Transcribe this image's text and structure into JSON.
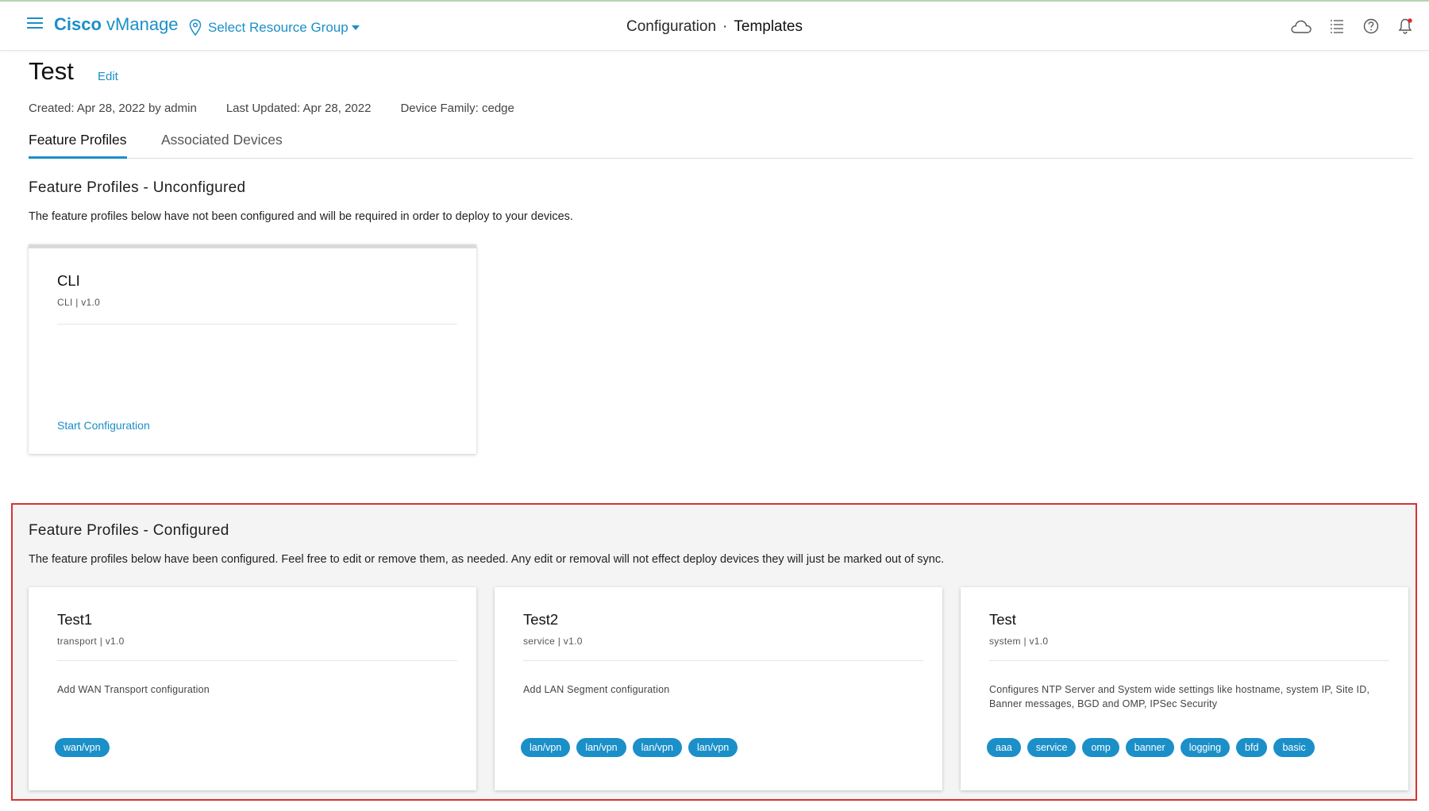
{
  "topbar": {
    "brand_bold": "Cisco",
    "brand_rest": " vManage",
    "resource_group": "Select Resource Group",
    "breadcrumb_parent": "Configuration",
    "breadcrumb_sep": "·",
    "breadcrumb_current": "Templates",
    "icons": [
      "cloud-icon",
      "task-list-icon",
      "help-icon",
      "notification-bell-icon"
    ],
    "accent_color": "#1b8fc8",
    "alert_color": "#e0282e"
  },
  "header": {
    "title": "Test",
    "edit_label": "Edit",
    "created": "Created: Apr 28, 2022 by admin",
    "last_updated": "Last Updated: Apr 28, 2022",
    "device_family": "Device Family: cedge"
  },
  "tabs": [
    {
      "label": "Feature Profiles",
      "active": true
    },
    {
      "label": "Associated Devices",
      "active": false
    }
  ],
  "unconfigured": {
    "title": "Feature Profiles - Unconfigured",
    "description": "The feature profiles below have not been configured and will be required in order to deploy to your devices.",
    "cards": [
      {
        "title": "CLI",
        "subtitle": "CLI | v1.0",
        "action": "Start Configuration"
      }
    ]
  },
  "configured": {
    "title": "Feature Profiles - Configured",
    "description": "The feature profiles below have been configured. Feel free to edit or remove them, as needed. Any edit or removal will not effect deploy devices they will just be marked out of sync.",
    "highlight_color": "#d63333",
    "cards": [
      {
        "title": "Test1",
        "subtitle": "transport | v1.0",
        "description": "Add WAN Transport configuration",
        "tags": [
          "wan/vpn"
        ]
      },
      {
        "title": "Test2",
        "subtitle": "service | v1.0",
        "description": "Add LAN Segment configuration",
        "tags": [
          "lan/vpn",
          "lan/vpn",
          "lan/vpn",
          "lan/vpn"
        ]
      },
      {
        "title": "Test",
        "subtitle": "system | v1.0",
        "description": "Configures NTP Server and System wide settings like hostname, system IP, Site ID, Banner messages, BGD and OMP, IPSec Security",
        "tags": [
          "aaa",
          "service",
          "omp",
          "banner",
          "logging",
          "bfd",
          "basic"
        ]
      }
    ]
  }
}
